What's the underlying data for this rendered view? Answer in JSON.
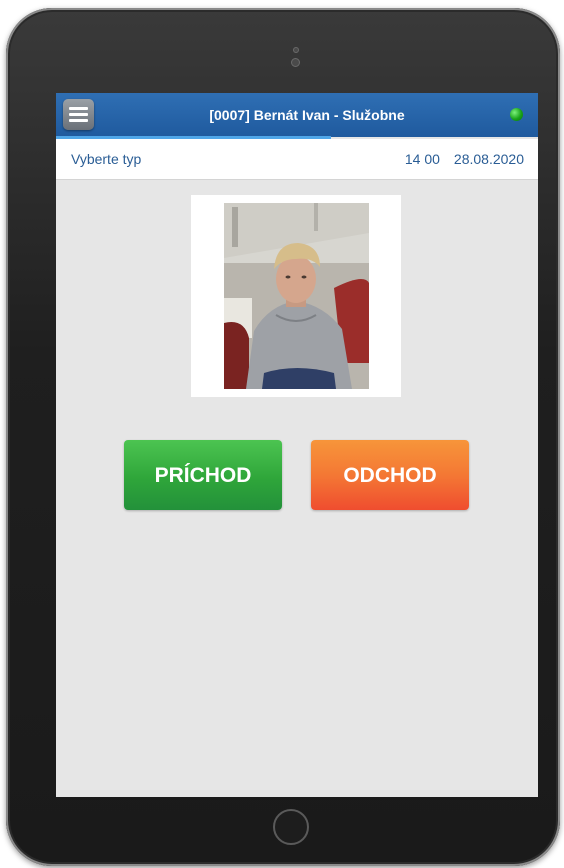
{
  "header": {
    "title": "[0007] Bernát Ivan - Služobne",
    "status_color": "#19a319"
  },
  "subheader": {
    "label": "Vyberte typ",
    "time": "14 00",
    "date": "28.08.2020"
  },
  "actions": {
    "arrival_label": "PRÍCHOD",
    "departure_label": "ODCHOD"
  },
  "colors": {
    "appbar": "#2f6fb4",
    "arrival": "#2fa63a",
    "departure": "#f47834"
  },
  "icons": {
    "menu": "hamburger-menu-icon",
    "status": "status-dot-icon",
    "home": "home-button-icon"
  }
}
